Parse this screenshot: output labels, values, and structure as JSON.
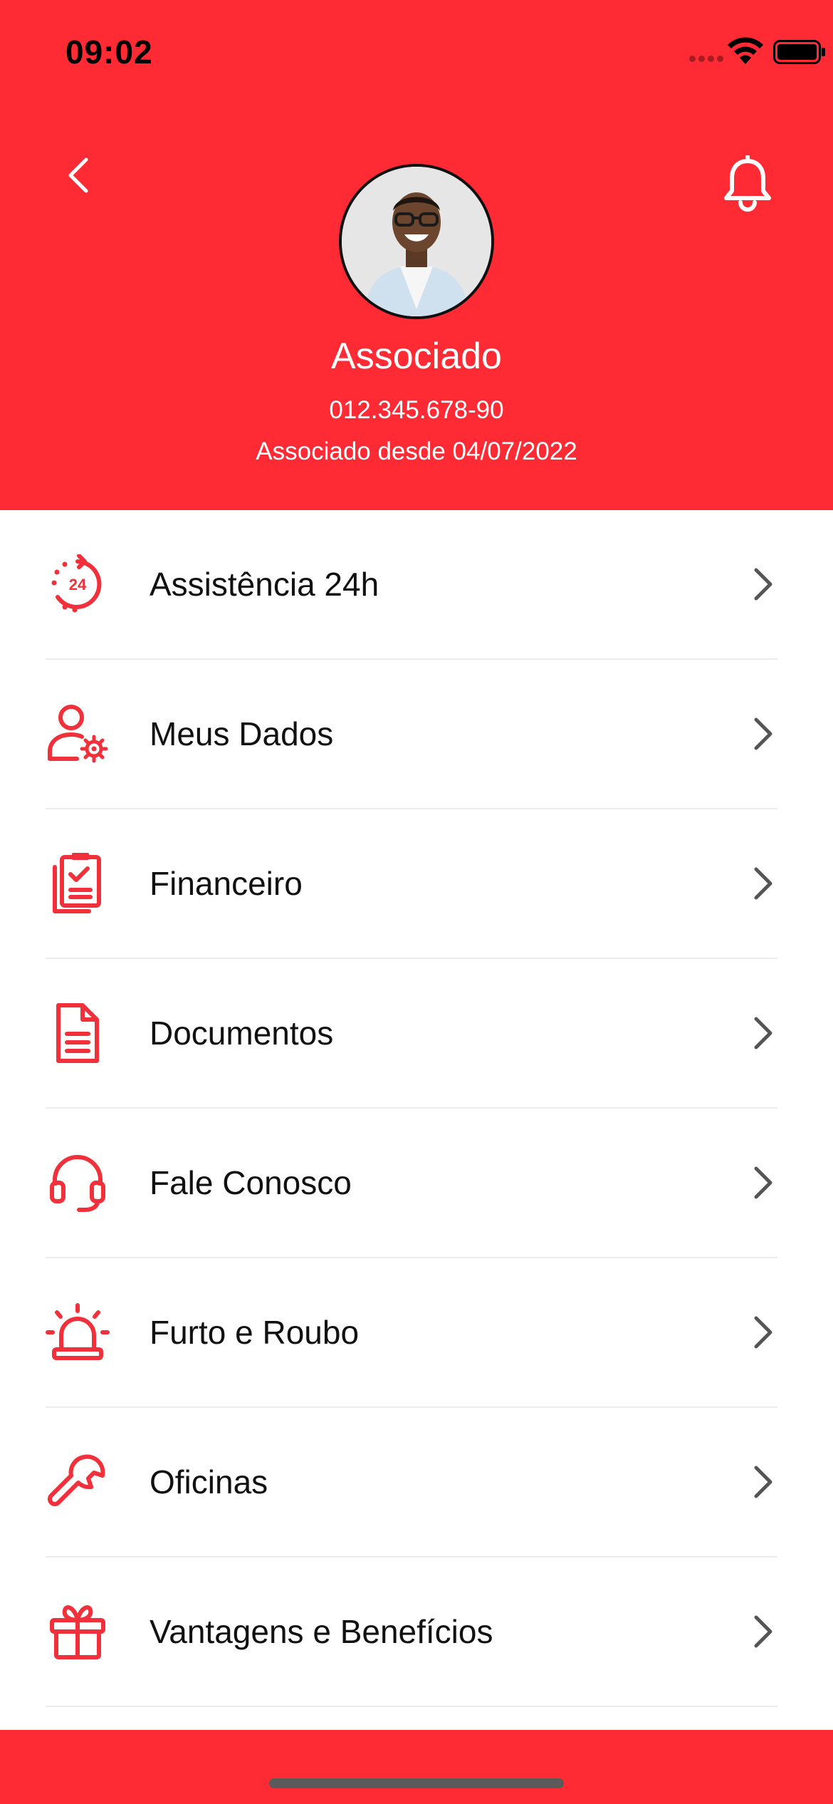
{
  "status_bar": {
    "time": "09:02"
  },
  "header": {
    "name": "Associado",
    "cpf": "012.345.678-90",
    "member_since": "Associado desde 04/07/2022"
  },
  "colors": {
    "brand_red": "#fe2b35",
    "text": "#111111",
    "divider": "#ececec"
  },
  "menu": [
    {
      "label": "Assistência 24h",
      "icon": "24h-assistance-icon"
    },
    {
      "label": "Meus Dados",
      "icon": "user-settings-icon"
    },
    {
      "label": "Financeiro",
      "icon": "financial-documents-icon"
    },
    {
      "label": "Documentos",
      "icon": "document-icon"
    },
    {
      "label": "Fale Conosco",
      "icon": "headset-icon"
    },
    {
      "label": "Furto e Roubo",
      "icon": "alarm-siren-icon"
    },
    {
      "label": "Oficinas",
      "icon": "wrench-icon"
    },
    {
      "label": "Vantagens e Benefícios",
      "icon": "gift-icon"
    }
  ]
}
